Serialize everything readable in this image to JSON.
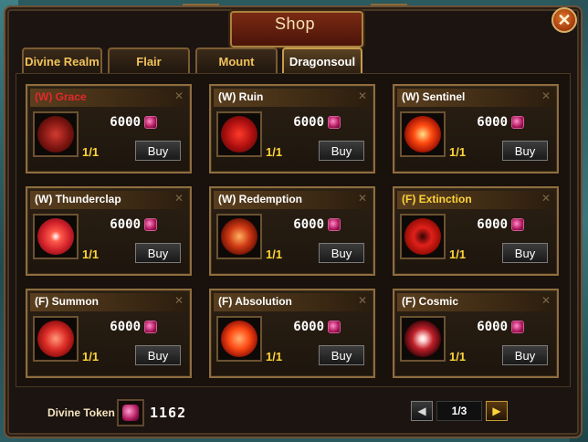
{
  "window": {
    "title": "Shop",
    "close_label": "✕"
  },
  "tabs": [
    {
      "label": "Divine Realm",
      "active": false
    },
    {
      "label": "Flair",
      "active": false
    },
    {
      "label": "Mount",
      "active": false
    },
    {
      "label": "Dragonsoul",
      "active": true
    }
  ],
  "items": [
    {
      "name": "(W) Grace",
      "name_color": "red",
      "price": "6000",
      "qty": "1/1",
      "buy_label": "Buy",
      "icon": "grace-orb-icon"
    },
    {
      "name": "(W) Ruin",
      "name_color": "white",
      "price": "6000",
      "qty": "1/1",
      "buy_label": "Buy",
      "icon": "ruin-orb-icon"
    },
    {
      "name": "(W) Sentinel",
      "name_color": "white",
      "price": "6000",
      "qty": "1/1",
      "buy_label": "Buy",
      "icon": "sentinel-orb-icon"
    },
    {
      "name": "(W) Thunderclap",
      "name_color": "white",
      "price": "6000",
      "qty": "1/1",
      "buy_label": "Buy",
      "icon": "thunderclap-orb-icon"
    },
    {
      "name": "(W) Redemption",
      "name_color": "white",
      "price": "6000",
      "qty": "1/1",
      "buy_label": "Buy",
      "icon": "redemption-orb-icon"
    },
    {
      "name": "(F) Extinction",
      "name_color": "gold",
      "price": "6000",
      "qty": "1/1",
      "buy_label": "Buy",
      "icon": "extinction-orb-icon"
    },
    {
      "name": "(F) Summon",
      "name_color": "white",
      "price": "6000",
      "qty": "1/1",
      "buy_label": "Buy",
      "icon": "summon-orb-icon"
    },
    {
      "name": "(F) Absolution",
      "name_color": "white",
      "price": "6000",
      "qty": "1/1",
      "buy_label": "Buy",
      "icon": "absolution-orb-icon"
    },
    {
      "name": "(F) Cosmic",
      "name_color": "white",
      "price": "6000",
      "qty": "1/1",
      "buy_label": "Buy",
      "icon": "cosmic-orb-icon"
    }
  ],
  "currency": {
    "label": "Divine Token",
    "value": "1162",
    "icon": "divine-token-icon"
  },
  "pagination": {
    "page_text": "1/3",
    "prev_icon": "◀",
    "next_icon": "▶"
  },
  "colors": {
    "red_name": "#e4282b",
    "gold_name": "#ffd43a",
    "qty": "#ffd43a"
  }
}
